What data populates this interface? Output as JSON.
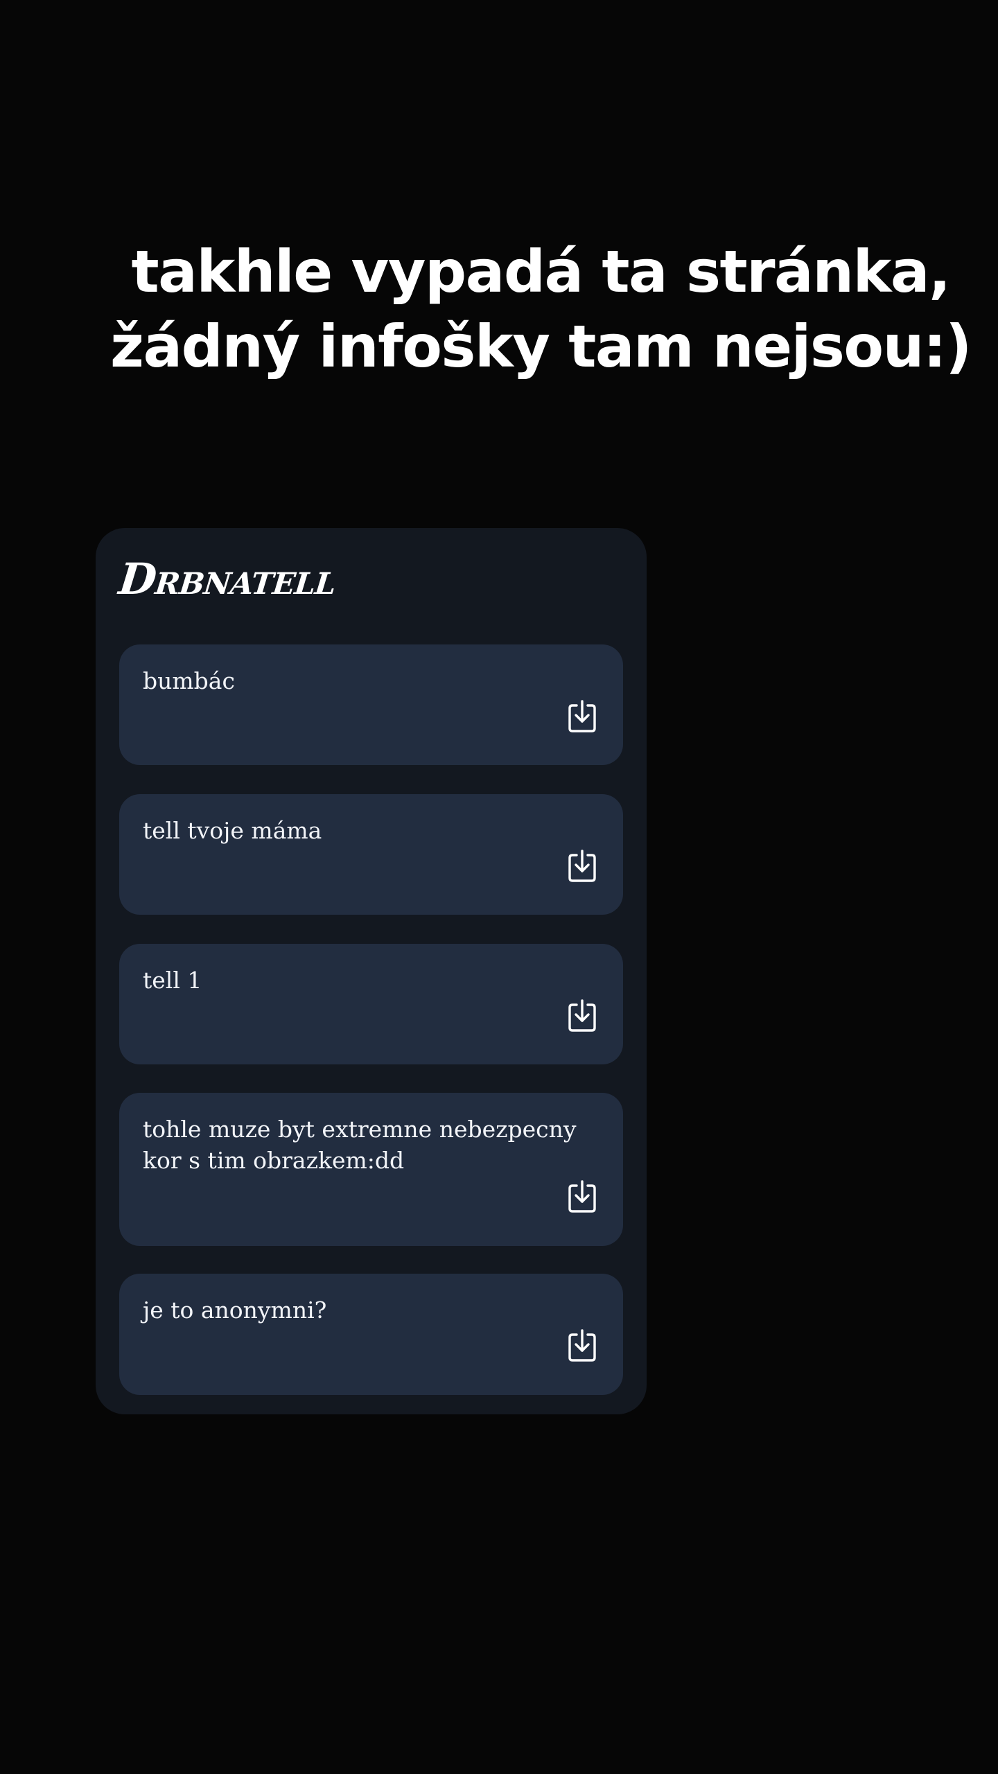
{
  "caption": {
    "line1": "takhle vypadá ta stránka,",
    "line2": "žádný infošky tam nejsou:)"
  },
  "app": {
    "brand": "Drbnatell"
  },
  "messages": [
    {
      "text": "bumbác",
      "icon": "download-icon"
    },
    {
      "text": "tell tvoje máma",
      "icon": "download-icon"
    },
    {
      "text": "tell 1",
      "icon": "download-icon"
    },
    {
      "text": "tohle muze byt extremne nebezpecny kor s tim obrazkem:dd",
      "icon": "download-icon"
    },
    {
      "text": "je to anonymni?",
      "icon": "download-icon"
    }
  ],
  "colors": {
    "background": "#060606",
    "panel": "#131820",
    "card": "#222d40",
    "text": "#ffffff"
  }
}
